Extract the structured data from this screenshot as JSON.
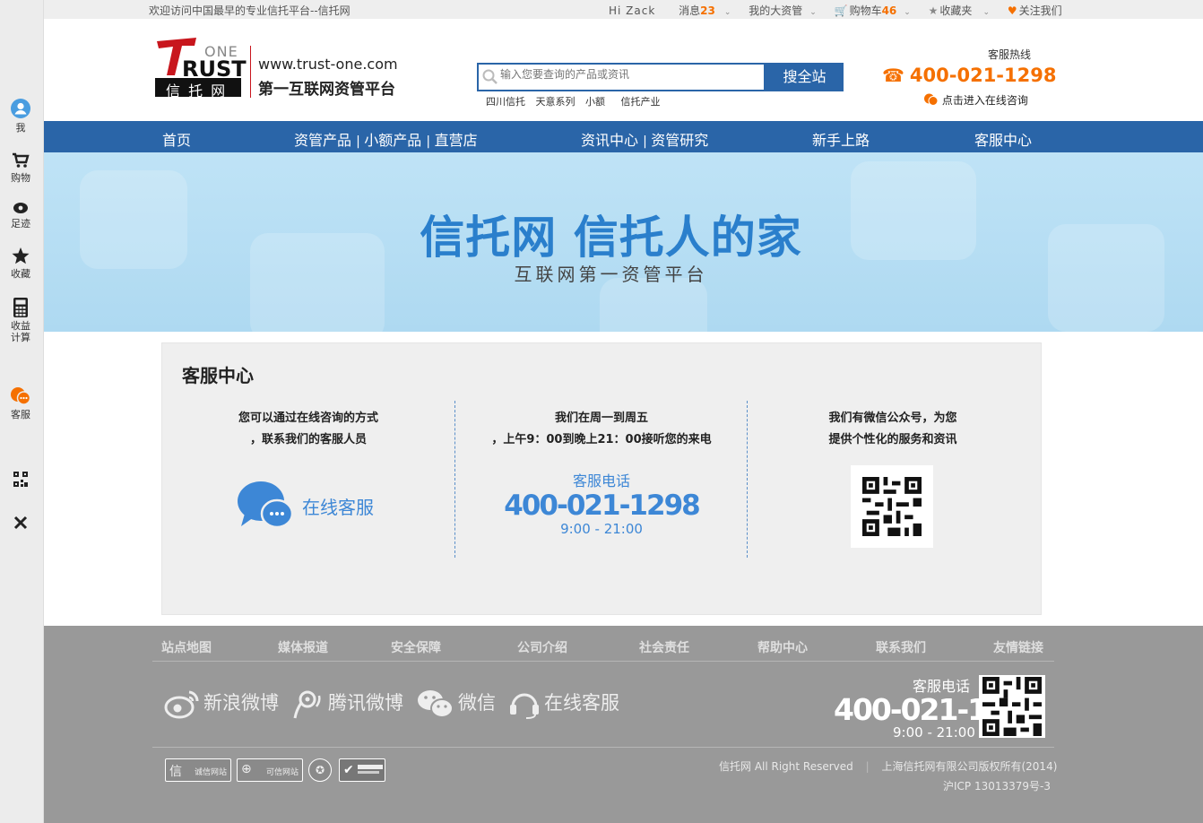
{
  "sidebar": {
    "items": [
      {
        "label": "我",
        "icon": "user-icon"
      },
      {
        "label": "购物",
        "icon": "cart-icon"
      },
      {
        "label": "足迹",
        "icon": "eye-icon"
      },
      {
        "label": "收藏",
        "icon": "star-icon"
      },
      {
        "label": "收益",
        "label2": "计算",
        "icon": "calculator-icon"
      },
      {
        "label": "客服",
        "icon": "chat-icon"
      },
      {
        "icon": "qrcode-icon"
      },
      {
        "icon": "close-icon"
      }
    ]
  },
  "topbar": {
    "welcome": "欢迎访问中国最早的专业信托平台--信托网",
    "greeting": "Hi  Zack",
    "messages_label": "消息",
    "messages_count": "23",
    "my_assets": "我的大资管",
    "cart_label": "购物车",
    "cart_count": "46",
    "favorites": "收藏夹",
    "follow": "关注我们"
  },
  "header": {
    "logo_one": "ONE",
    "logo_rust": "RUST",
    "logo_cn": "信 托 网",
    "url": "www.trust-one.com",
    "slogan": "第一互联网资管平台",
    "search_placeholder": "输入您要查询的产品或资讯",
    "search_button": "搜全站",
    "hot_keys": [
      "四川信托",
      "天意系列",
      "小额",
      "信托产业"
    ],
    "hotline_label": "客服热线",
    "hotline_number": "400-021-1298",
    "online_consult": "点击进入在线咨询"
  },
  "nav": {
    "home": "首页",
    "products": "资管产品",
    "small": "小额产品",
    "direct": "直营店",
    "news": "资讯中心",
    "research": "资管研究",
    "beginner": "新手上路",
    "service": "客服中心"
  },
  "banner": {
    "title": "信托网  信托人的家",
    "subtitle": "互联网第一资管平台"
  },
  "cs": {
    "title": "客服中心",
    "col1_line1": "您可以通过在线咨询的方式",
    "col1_line2": "，联系我们的客服人员",
    "online_label": "在线客服",
    "col2_line1": "我们在周一到周五",
    "col2_line2": "，上午9：00到晚上21：00接听您的来电",
    "phone_label": "客服电话",
    "phone_number": "400-021-1298",
    "phone_hours": "9:00 - 21:00",
    "col3_line1": "我们有微信公众号，为您",
    "col3_line2": "提供个性化的服务和资讯"
  },
  "footer": {
    "links": [
      "站点地图",
      "媒体报道",
      "安全保障",
      "公司介绍",
      "社会责任",
      "帮助中心",
      "联系我们",
      "友情链接"
    ],
    "social": [
      "新浪微博",
      "腾讯微博",
      "微信",
      "在线客服"
    ],
    "cs_label": "客服电话",
    "cs_number": "400-021-1298",
    "cs_hours": "9:00 - 21:00",
    "badges": [
      "诚信网站",
      "可信网站"
    ],
    "copyright": "信托网 All Right Reserved",
    "company": "上海信托网有限公司版权所有(2014)",
    "icp": "沪ICP 13013379号-3"
  },
  "colors": {
    "brand_blue": "#2a65a8",
    "accent_orange": "#f57000",
    "logo_red": "#c8161d"
  }
}
